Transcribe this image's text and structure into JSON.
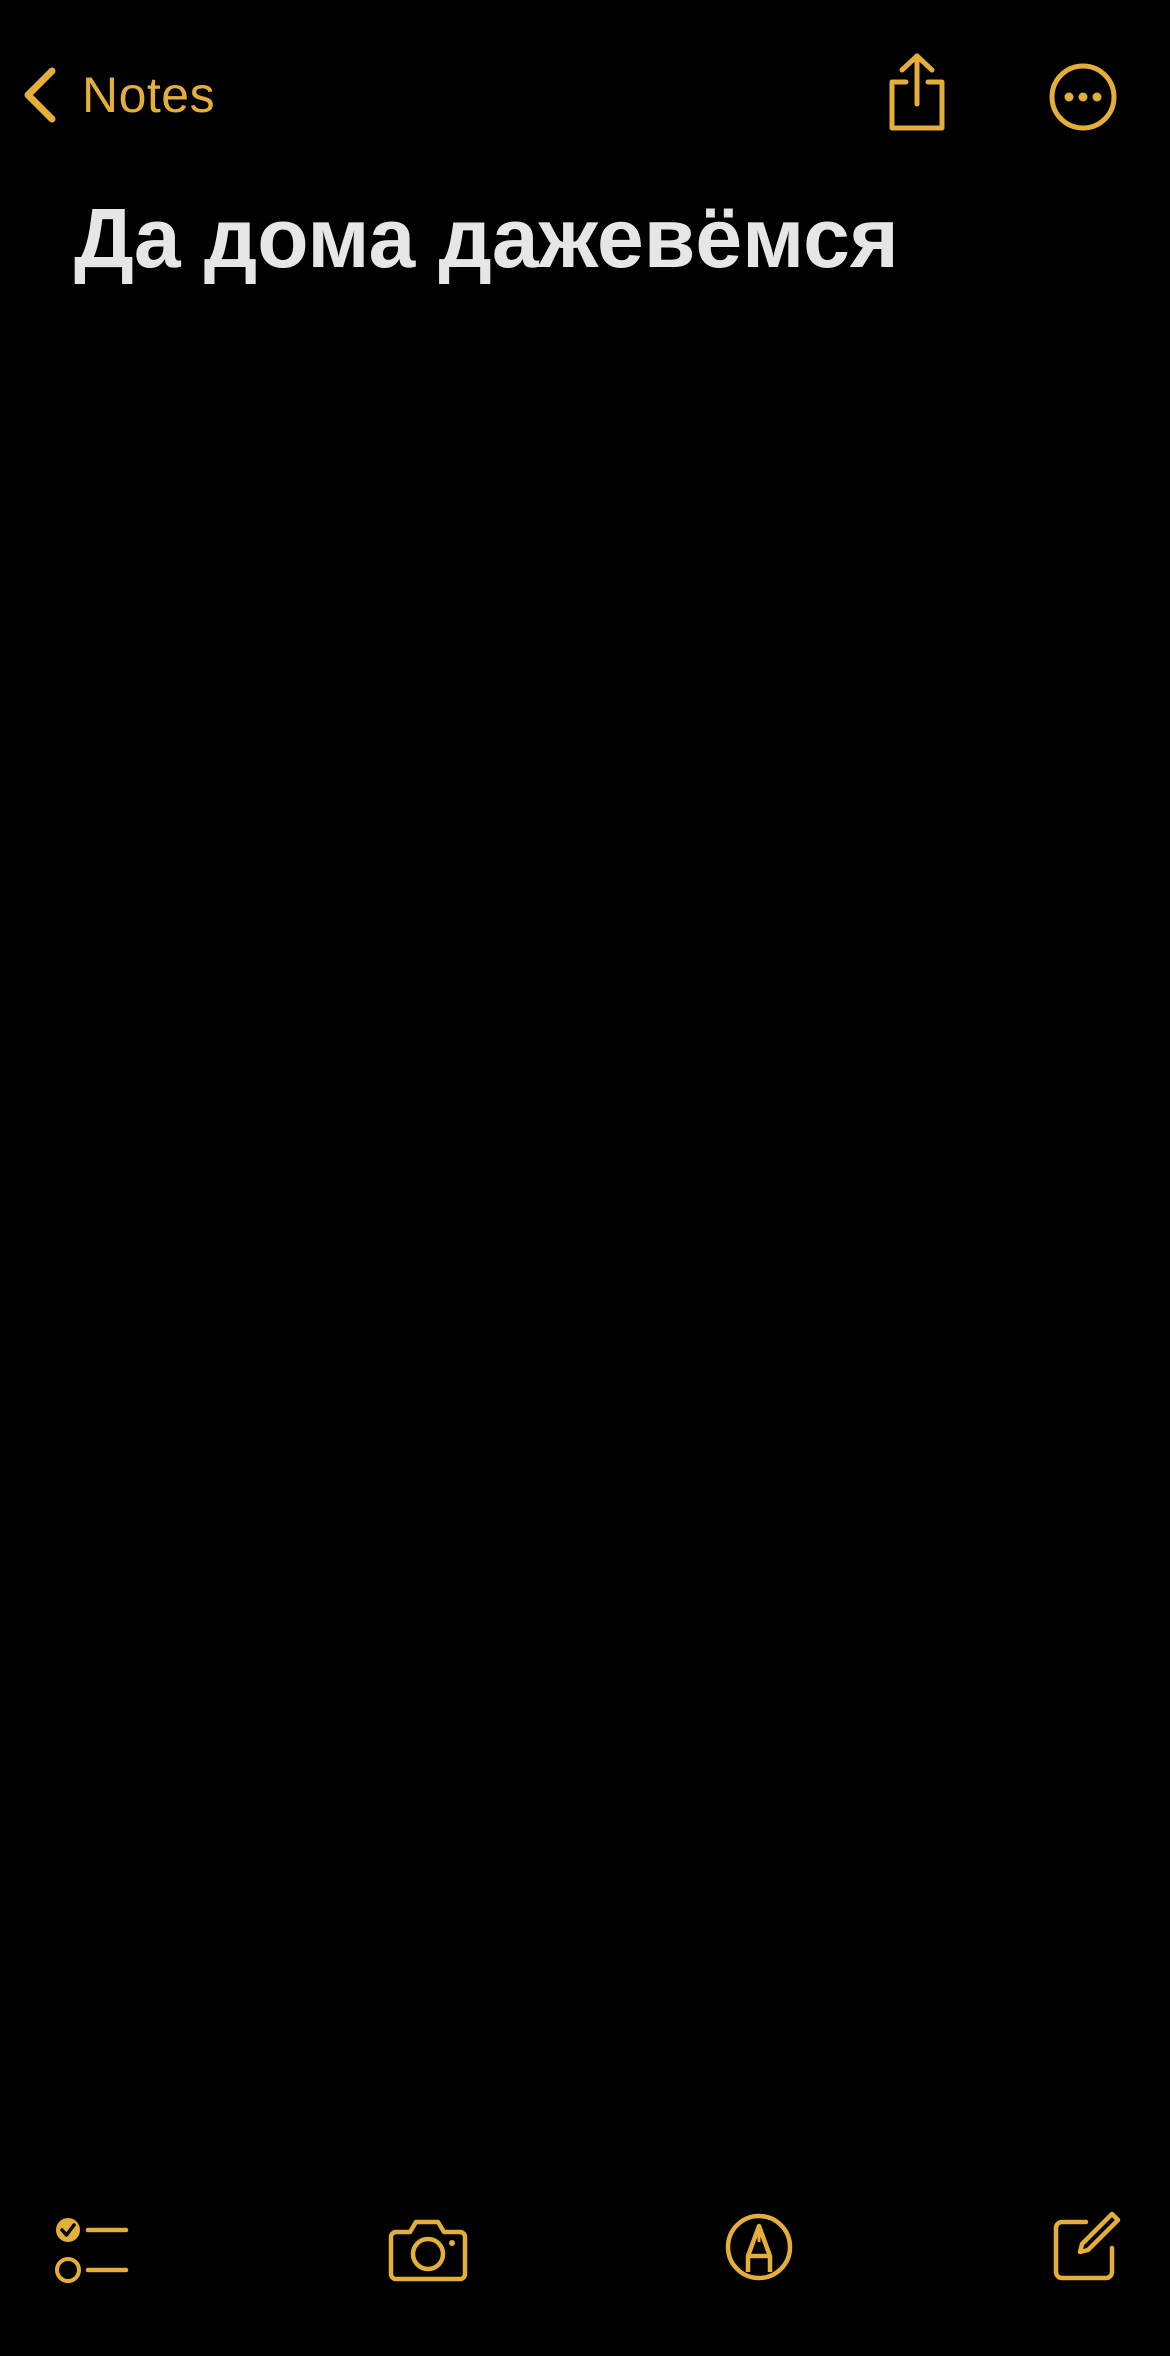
{
  "nav": {
    "back_label": "Notes",
    "icons": {
      "back": "chevron-left-icon",
      "share": "share-icon",
      "more": "ellipsis-circle-icon"
    }
  },
  "note": {
    "title": "Да дома дажевёмся"
  },
  "toolbar": {
    "icons": [
      "checklist-icon",
      "camera-icon",
      "markup-pen-icon",
      "compose-icon"
    ]
  },
  "colors": {
    "accent": "#E4AE3A",
    "background": "#000000",
    "title_text": "#E6E6E6"
  }
}
